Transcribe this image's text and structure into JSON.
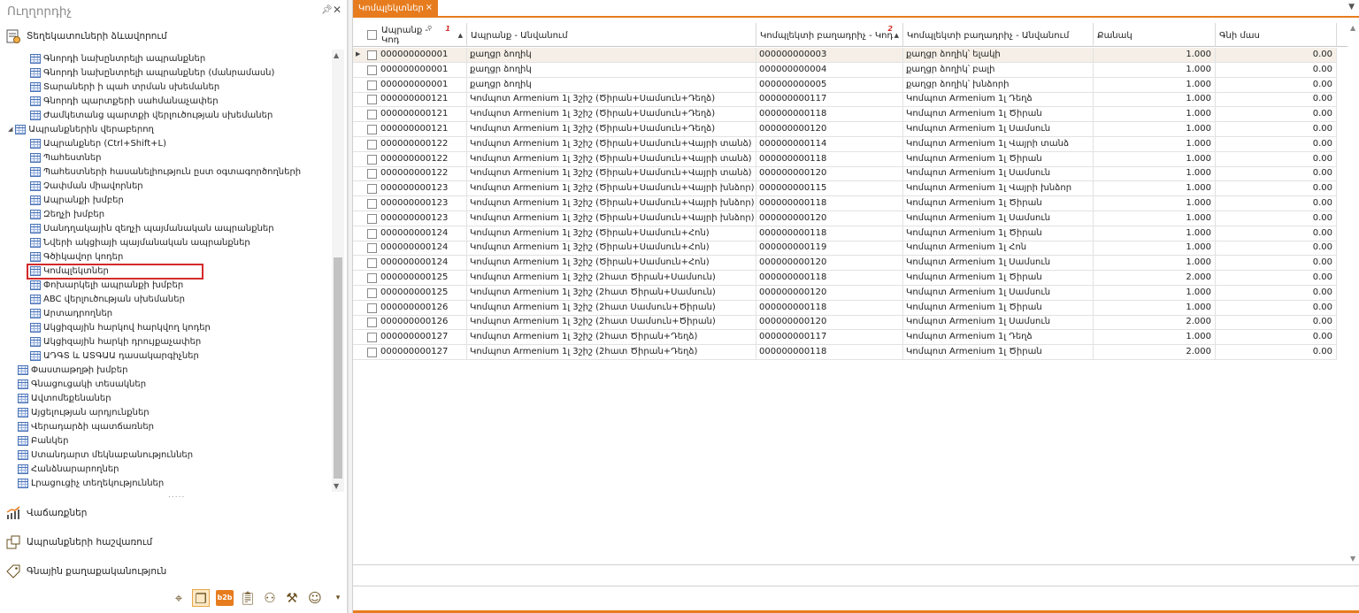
{
  "navigator": {
    "title": "Ուղղորդիչ",
    "pin_icon": "pin-icon",
    "close_icon": "close-icon",
    "top_group": {
      "label": "Տեղեկատուների ձևավորում",
      "icon": "document-gear-icon"
    },
    "tree_items": [
      {
        "label": "Գնորդի նախընտրելի ապրանքներ",
        "indent": 1
      },
      {
        "label": "Գնորդի նախընտրելի ապրանքներ (մանրամասն)",
        "indent": 1
      },
      {
        "label": "Տարաների ի պահ տրման սխեմաներ",
        "indent": 1
      },
      {
        "label": "Գնորդի պարտքերի սահմանաչափեր",
        "indent": 1
      },
      {
        "label": "Ժամկետանց պարտքի վերլուծության սխեմաներ",
        "indent": 1
      },
      {
        "label": "Ապրանքներին վերաբերող",
        "indent": 0,
        "expander": true
      },
      {
        "label": "Ապրանքներ (Ctrl+Shift+L)",
        "indent": 1
      },
      {
        "label": "Պահեստներ",
        "indent": 1
      },
      {
        "label": "Պահեստների հասանելիություն ըստ օգտագործողների",
        "indent": 1
      },
      {
        "label": "Չափման միավորներ",
        "indent": 1
      },
      {
        "label": "Ապրանքի խմբեր",
        "indent": 1
      },
      {
        "label": "Զեղչի խմբեր",
        "indent": 1
      },
      {
        "label": "Սանդղակային զեղչի պայմանական ապրանքներ",
        "indent": 1
      },
      {
        "label": "Նվերի ակցիայի պայմանական ապրանքներ",
        "indent": 1
      },
      {
        "label": "Գծիկավոր կոդեր",
        "indent": 1
      },
      {
        "label": "Կոմպլեկտներ",
        "indent": 1,
        "selected": true
      },
      {
        "label": "Փոխարկելի ապրանքի խմբեր",
        "indent": 1
      },
      {
        "label": "ABC վերլուծության սխեմաներ",
        "indent": 1
      },
      {
        "label": "Արտադրողներ",
        "indent": 1
      },
      {
        "label": "Ակցիզային հարկով հարկվող կոդեր",
        "indent": 1
      },
      {
        "label": "Ակցիզային հարկի դրույքաչափեր",
        "indent": 1
      },
      {
        "label": "ԱԴԳՏ և ԱՏԳԱԱ դասակարգիչներ",
        "indent": 1
      },
      {
        "label": "Փաստաթղթի խմբեր",
        "indent": 0
      },
      {
        "label": "Գնացուցակի տեսակներ",
        "indent": 0
      },
      {
        "label": "Ավտոմեքենաներ",
        "indent": 0
      },
      {
        "label": "Այցելության արդյունքներ",
        "indent": 0
      },
      {
        "label": "Վերադարձի պատճառներ",
        "indent": 0
      },
      {
        "label": "Բանկեր",
        "indent": 0
      },
      {
        "label": "Ստանդարտ մեկնաբանություններ",
        "indent": 0
      },
      {
        "label": "Հանձնարարողներ",
        "indent": 0
      },
      {
        "label": "Լրացուցիչ տեղեկություններ",
        "indent": 0
      }
    ],
    "groups": [
      {
        "label": "Վաճառքներ",
        "icon": "sales-chart-icon"
      },
      {
        "label": "Ապրանքների հաշվառում",
        "icon": "boxes-icon"
      },
      {
        "label": "Գնային քաղաքականություն",
        "icon": "price-tag-icon"
      }
    ],
    "bottom_icons": [
      "map-pin-icon",
      "documents-icon",
      "b2b-icon",
      "clipboard-icon",
      "user-edit-icon",
      "tools-icon",
      "user-icon",
      "chevron-down-icon"
    ],
    "b2b_label": "b2b",
    "dots": "....."
  },
  "tab": {
    "label": "Կոմպլեկտներ",
    "close": "×"
  },
  "grid": {
    "columns": [
      {
        "label": "Ապրանք - Կոդ",
        "sort_index": "1"
      },
      {
        "label": "Ապրանք - Անվանում"
      },
      {
        "label": "Կոմպլեկտի բաղադրիչ - Կոդ",
        "sort_index": "2"
      },
      {
        "label": "Կոմպլեկտի բաղադրիչ - Անվանում"
      },
      {
        "label": "Քանակ"
      },
      {
        "label": "Գնի մաս"
      }
    ],
    "rows": [
      [
        "000000000001",
        "քաղցր ձողիկ",
        "000000000003",
        "քաղցր ձողիկ՝ ելակի",
        "1.000",
        "0.00"
      ],
      [
        "000000000001",
        "քաղցր ձողիկ",
        "000000000004",
        "քաղցր ձողիկ՝ բալի",
        "1.000",
        "0.00"
      ],
      [
        "000000000001",
        "քաղցր ձողիկ",
        "000000000005",
        "քաղցր ձողիկ՝ խնձորի",
        "1.000",
        "0.00"
      ],
      [
        "000000000121",
        "Կոմպոտ Armenium 1լ 3շիշ (Ծիրան+Սամսուն+Դեղձ)",
        "000000000117",
        "Կոմպոտ Armenium 1լ Դեղձ",
        "1.000",
        "0.00"
      ],
      [
        "000000000121",
        "Կոմպոտ Armenium 1լ 3շիշ (Ծիրան+Սամսուն+Դեղձ)",
        "000000000118",
        "Կոմպոտ Armenium 1լ Ծիրան",
        "1.000",
        "0.00"
      ],
      [
        "000000000121",
        "Կոմպոտ Armenium 1լ 3շիշ (Ծիրան+Սամսուն+Դեղձ)",
        "000000000120",
        "Կոմպոտ Armenium 1լ Սամսուն",
        "1.000",
        "0.00"
      ],
      [
        "000000000122",
        "Կոմպոտ Armenium 1լ 3շիշ (Ծիրան+Սամսուն+Վայրի տանձ)",
        "000000000114",
        "Կոմպոտ Armenium 1լ Վայրի տանձ",
        "1.000",
        "0.00"
      ],
      [
        "000000000122",
        "Կոմպոտ Armenium 1լ 3շիշ (Ծիրան+Սամսուն+Վայրի տանձ)",
        "000000000118",
        "Կոմպոտ Armenium 1լ Ծիրան",
        "1.000",
        "0.00"
      ],
      [
        "000000000122",
        "Կոմպոտ Armenium 1լ 3շիշ (Ծիրան+Սամսուն+Վայրի տանձ)",
        "000000000120",
        "Կոմպոտ Armenium 1լ Սամսուն",
        "1.000",
        "0.00"
      ],
      [
        "000000000123",
        "Կոմպոտ Armenium 1լ 3շիշ (Ծիրան+Սամսուն+Վայրի խնձոր)",
        "000000000115",
        "Կոմպոտ Armenium 1լ Վայրի խնձոր",
        "1.000",
        "0.00"
      ],
      [
        "000000000123",
        "Կոմպոտ Armenium 1լ 3շիշ (Ծիրան+Սամսուն+Վայրի խնձոր)",
        "000000000118",
        "Կոմպոտ Armenium 1լ Ծիրան",
        "1.000",
        "0.00"
      ],
      [
        "000000000123",
        "Կոմպոտ Armenium 1լ 3շիշ (Ծիրան+Սամսուն+Վայրի խնձոր)",
        "000000000120",
        "Կոմպոտ Armenium 1լ Սամսուն",
        "1.000",
        "0.00"
      ],
      [
        "000000000124",
        "Կոմպոտ Armenium 1լ 3շիշ (Ծիրան+Սամսուն+Հոն)",
        "000000000118",
        "Կոմպոտ Armenium 1լ Ծիրան",
        "1.000",
        "0.00"
      ],
      [
        "000000000124",
        "Կոմպոտ Armenium 1լ 3շիշ (Ծիրան+Սամսուն+Հոն)",
        "000000000119",
        "Կոմպոտ Armenium 1լ Հոն",
        "1.000",
        "0.00"
      ],
      [
        "000000000124",
        "Կոմպոտ Armenium 1լ 3շիշ (Ծիրան+Սամսուն+Հոն)",
        "000000000120",
        "Կոմպոտ Armenium 1լ Սամսուն",
        "1.000",
        "0.00"
      ],
      [
        "000000000125",
        "Կոմպոտ Armenium 1լ 3շիշ (2հատ Ծիրան+Սամսուն)",
        "000000000118",
        "Կոմպոտ Armenium 1լ Ծիրան",
        "2.000",
        "0.00"
      ],
      [
        "000000000125",
        "Կոմպոտ Armenium 1լ 3շիշ (2հատ Ծիրան+Սամսուն)",
        "000000000120",
        "Կոմպոտ Armenium 1լ Սամսուն",
        "1.000",
        "0.00"
      ],
      [
        "000000000126",
        "Կոմպոտ Armenium 1լ 3շիշ (2հատ Սամսուն+Ծիրան)",
        "000000000118",
        "Կոմպոտ Armenium 1լ Ծիրան",
        "1.000",
        "0.00"
      ],
      [
        "000000000126",
        "Կոմպոտ Armenium 1լ 3շիշ (2հատ Սամսուն+Ծիրան)",
        "000000000120",
        "Կոմպոտ Armenium 1լ Սամսուն",
        "2.000",
        "0.00"
      ],
      [
        "000000000127",
        "Կոմպոտ Armenium 1լ 3շիշ (2հատ Ծիրան+Դեղձ)",
        "000000000117",
        "Կոմպոտ Armenium 1լ Դեղձ",
        "1.000",
        "0.00"
      ],
      [
        "000000000127",
        "Կոմպոտ Armenium 1լ 3շիշ (2հատ Ծիրան+Դեղձ)",
        "000000000118",
        "Կոմպոտ Armenium 1լ Ծիրան",
        "2.000",
        "0.00"
      ]
    ]
  },
  "colors": {
    "accent": "#e77c1e",
    "selection_border": "#d42a2a",
    "focused_row": "#f5efe7"
  }
}
